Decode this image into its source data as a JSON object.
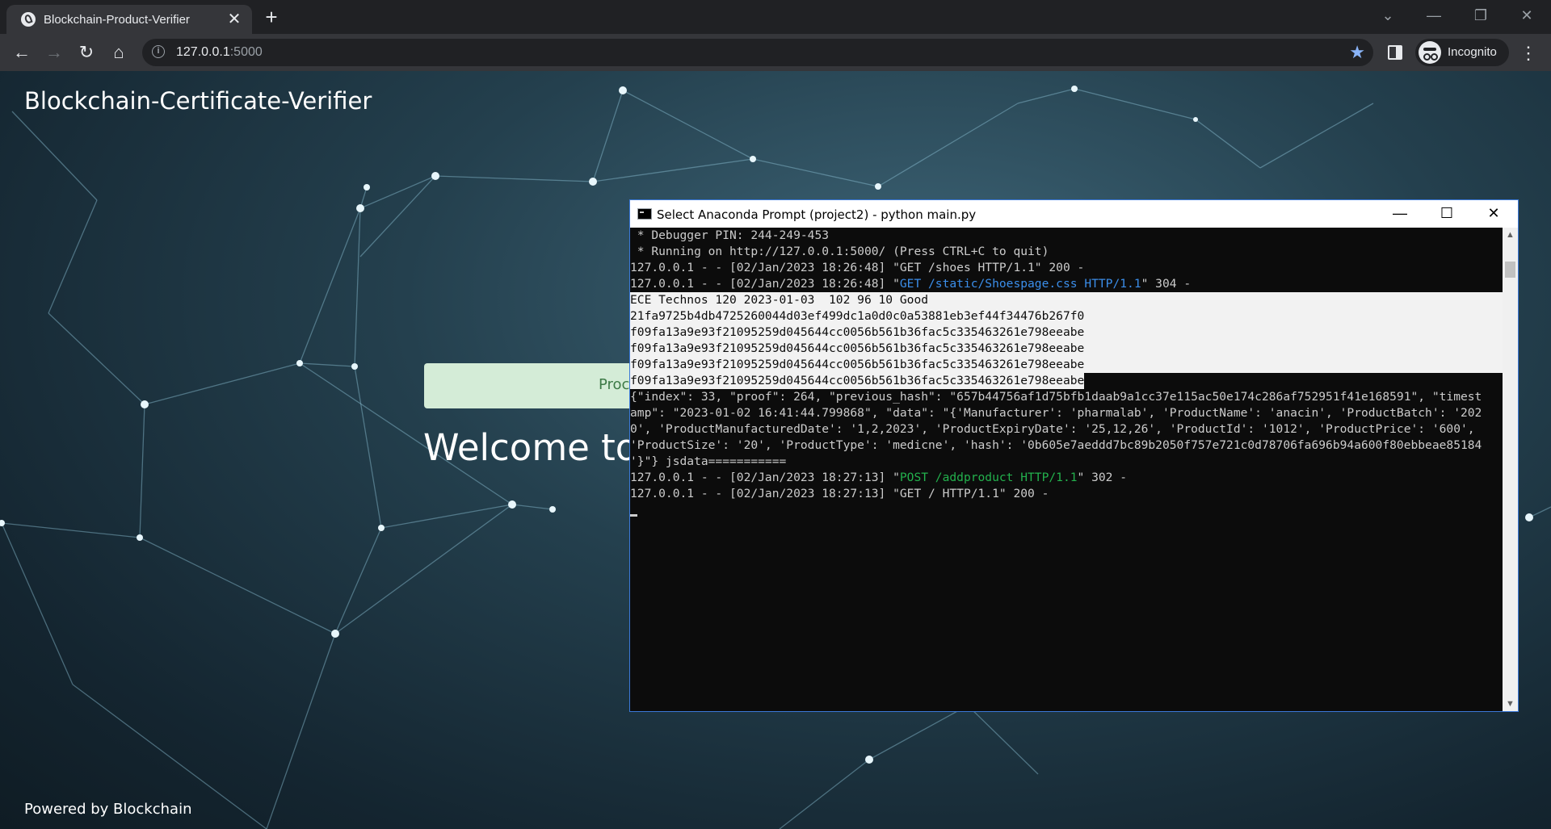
{
  "browser": {
    "tab_title": "Blockchain-Product-Verifier",
    "tab_close_glyph": "✕",
    "new_tab_glyph": "+",
    "url_host": "127.0.0.1",
    "url_port": ":5000",
    "profile_label": "Incognito",
    "back_glyph": "←",
    "forward_glyph": "→",
    "reload_glyph": "↻",
    "home_glyph": "⌂",
    "star_glyph": "★",
    "menu_glyph": "⋮",
    "info_glyph": "i",
    "win_tabsearch_glyph": "⌄",
    "win_minimize_glyph": "—",
    "win_restore_glyph": "❐",
    "win_close_glyph": "✕"
  },
  "page": {
    "brand": "Blockchain-Certificate-Verifier",
    "product_button_label": "Proc",
    "welcome_text": "Welcome to",
    "footer": "Powered by Blockchain"
  },
  "console": {
    "title": "Select Anaconda Prompt (project2) - python  main.py",
    "minimize_glyph": "—",
    "maximize_glyph": "☐",
    "close_glyph": "✕",
    "scroll_up_glyph": "▲",
    "scroll_down_glyph": "▼",
    "lines": {
      "l1": " * Debugger PIN: 244-249-453",
      "l2": " * Running on http://127.0.0.1:5000/ (Press CTRL+C to quit)",
      "l3": "127.0.0.1 - - [02/Jan/2023 18:26:48] \"GET /shoes HTTP/1.1\" 200 -",
      "l4a": "127.0.0.1 - - [02/Jan/2023 18:26:48] \"",
      "l4b": "GET /static/Shoespage.css HTTP/1.1",
      "l4c": "\" 304 -",
      "l5": "ECE Technos 120 2023-01-03  102 96 10 Good",
      "l6": "21fa9725b4db4725260044d03ef499dc1a0d0c0a53881eb3ef44f34476b267f0",
      "l7": "f09fa13a9e93f21095259d045644cc0056b561b36fac5c335463261e798eeabe",
      "l8": "f09fa13a9e93f21095259d045644cc0056b561b36fac5c335463261e798eeabe",
      "l9": "f09fa13a9e93f21095259d045644cc0056b561b36fac5c335463261e798eeabe",
      "l10": "f09fa13a9e93f21095259d045644cc0056b561b36fac5c335463261e798eeabe",
      "l11": "{\"index\": 33, \"proof\": 264, \"previous_hash\": \"657b44756af1d75bfb1daab9a1cc37e115ac50e174c286af752951f41e168591\", \"timest",
      "l12": "amp\": \"2023-01-02 16:41:44.799868\", \"data\": \"{'Manufacturer': 'pharmalab', 'ProductName': 'anacin', 'ProductBatch': '202",
      "l13": "0', 'ProductManufacturedDate': '1,2,2023', 'ProductExpiryDate': '25,12,26', 'ProductId': '1012', 'ProductPrice': '600',",
      "l14": "'ProductSize': '20', 'ProductType': 'medicne', 'hash': '0b605e7aeddd7bc89b2050f757e721c0d78706fa696b94a600f80ebbeae85184",
      "l15": "'}\"} jsdata===========",
      "l16a": "127.0.0.1 - - [02/Jan/2023 18:27:13] \"",
      "l16b": "POST /addproduct HTTP/1.1",
      "l16c": "\" 302 -",
      "l17": "127.0.0.1 - - [02/Jan/2023 18:27:13] \"GET / HTTP/1.1\" 200 -"
    }
  }
}
